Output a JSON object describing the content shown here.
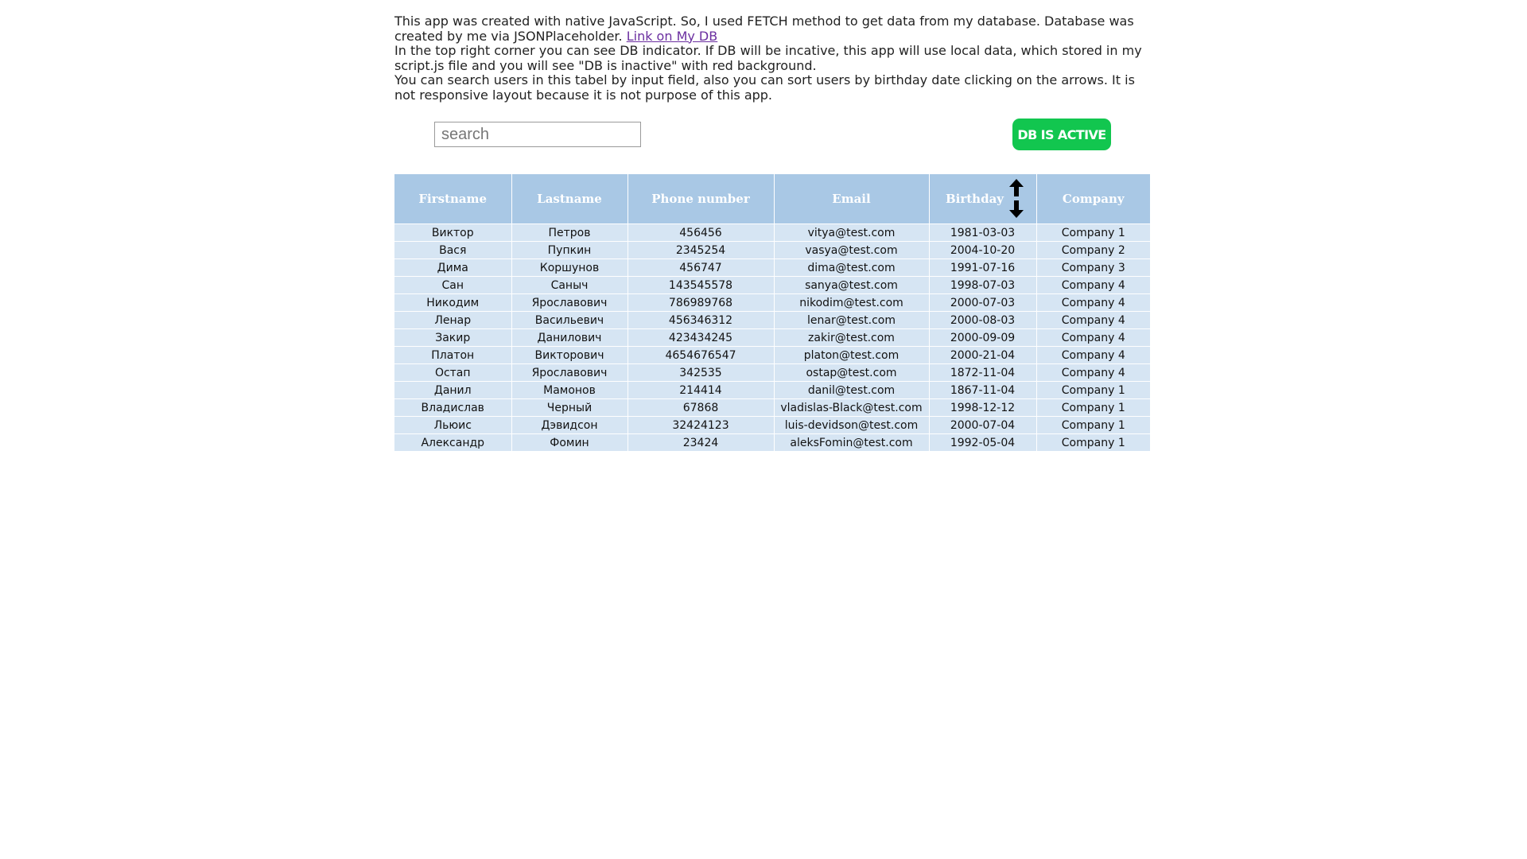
{
  "intro": {
    "line1_text": "This app was created with native JavaScript. So, I used FETCH method to get data from my database. Database was created by me via JSONPlaceholder. ",
    "link_label": "Link on My DB",
    "line2": "In the top right corner you can see DB indicator. If DB will be incative, this app will use local data, which stored in my script.js file and you will see \"DB is inactive\" with red background.",
    "line3": "You can search users in this tabel by input field, also you can sort users by birthday date clicking on the arrows. It is not responsive layout because it is not purpose of this app."
  },
  "search": {
    "placeholder": "search",
    "value": ""
  },
  "db_indicator": {
    "label": "DB IS ACTIVE",
    "color": "#12c64f"
  },
  "table": {
    "headers": {
      "firstname": "Firstname",
      "lastname": "Lastname",
      "phone": "Phone number",
      "email": "Email",
      "birthday": "Birthday",
      "company": "Company"
    },
    "sort_icons": [
      "arrow-up-icon",
      "arrow-down-icon"
    ],
    "rows": [
      {
        "firstname": "Виктор",
        "lastname": "Петров",
        "phone": "456456",
        "email": "vitya@test.com",
        "birthday": "1981-03-03",
        "company": "Company 1"
      },
      {
        "firstname": "Вася",
        "lastname": "Пупкин",
        "phone": "2345254",
        "email": "vasya@test.com",
        "birthday": "2004-10-20",
        "company": "Company 2"
      },
      {
        "firstname": "Дима",
        "lastname": "Коршунов",
        "phone": "456747",
        "email": "dima@test.com",
        "birthday": "1991-07-16",
        "company": "Company 3"
      },
      {
        "firstname": "Сан",
        "lastname": "Саныч",
        "phone": "143545578",
        "email": "sanya@test.com",
        "birthday": "1998-07-03",
        "company": "Company 4"
      },
      {
        "firstname": "Никодим",
        "lastname": "Ярославович",
        "phone": "786989768",
        "email": "nikodim@test.com",
        "birthday": "2000-07-03",
        "company": "Company 4"
      },
      {
        "firstname": "Ленар",
        "lastname": "Васильевич",
        "phone": "456346312",
        "email": "lenar@test.com",
        "birthday": "2000-08-03",
        "company": "Company 4"
      },
      {
        "firstname": "Закир",
        "lastname": "Данилович",
        "phone": "423434245",
        "email": "zakir@test.com",
        "birthday": "2000-09-09",
        "company": "Company 4"
      },
      {
        "firstname": "Платон",
        "lastname": "Викторович",
        "phone": "4654676547",
        "email": "platon@test.com",
        "birthday": "2000-21-04",
        "company": "Company 4"
      },
      {
        "firstname": "Остап",
        "lastname": "Ярославович",
        "phone": "342535",
        "email": "ostap@test.com",
        "birthday": "1872-11-04",
        "company": "Company 4"
      },
      {
        "firstname": "Данил",
        "lastname": "Мамонов",
        "phone": "214414",
        "email": "danil@test.com",
        "birthday": "1867-11-04",
        "company": "Company 1"
      },
      {
        "firstname": "Владислав",
        "lastname": "Черный",
        "phone": "67868",
        "email": "vladislas-Black@test.com",
        "birthday": "1998-12-12",
        "company": "Company 1"
      },
      {
        "firstname": "Льюис",
        "lastname": "Дэвидсон",
        "phone": "32424123",
        "email": "luis-devidson@test.com",
        "birthday": "2000-07-04",
        "company": "Company 1"
      },
      {
        "firstname": "Александр",
        "lastname": "Фомин",
        "phone": "23424",
        "email": "aleksFomin@test.com",
        "birthday": "1992-05-04",
        "company": "Company 1"
      }
    ]
  }
}
